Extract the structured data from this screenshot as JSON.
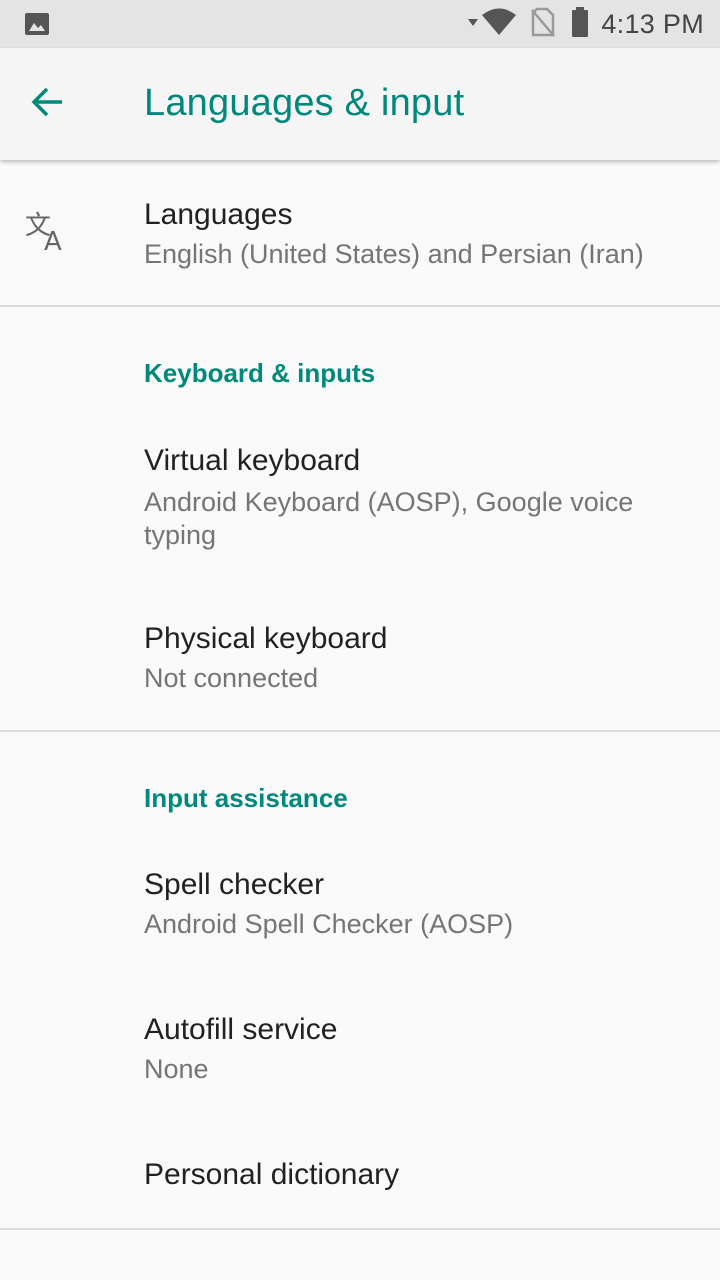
{
  "status_bar": {
    "time": "4:13 PM",
    "icons": [
      "image-notification-icon",
      "data-arrow-icon",
      "wifi-icon",
      "no-sim-icon",
      "battery-icon"
    ]
  },
  "app_bar": {
    "back_icon": "arrow-back-icon",
    "title": "Languages & input"
  },
  "colors": {
    "accent": "#00897b",
    "text_primary": "#212121",
    "text_secondary": "#757575"
  },
  "items": {
    "languages": {
      "icon": "translate-icon",
      "title": "Languages",
      "summary": "English (United States) and Persian (Iran)"
    },
    "keyboard_category": "Keyboard & inputs",
    "virtual_keyboard": {
      "title": "Virtual keyboard",
      "summary": "Android Keyboard (AOSP), Google voice typing"
    },
    "physical_keyboard": {
      "title": "Physical keyboard",
      "summary": "Not connected"
    },
    "assistance_category": "Input assistance",
    "spell_checker": {
      "title": "Spell checker",
      "summary": "Android Spell Checker (AOSP)"
    },
    "autofill": {
      "title": "Autofill service",
      "summary": "None"
    },
    "dictionary": {
      "title": "Personal dictionary"
    }
  }
}
